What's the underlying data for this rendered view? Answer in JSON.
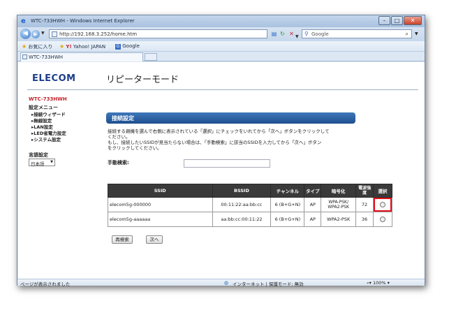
{
  "window": {
    "title": "WTC-733HWH - Windows Internet Explorer",
    "buttons": {
      "minimize": "–",
      "maximize": "□",
      "close": "✕"
    }
  },
  "address_bar": {
    "url": "http://192.168.3.252/home.htm",
    "search_placeholder": "Google"
  },
  "favorites_bar": {
    "favorites_label": "お気に入り",
    "links": [
      {
        "label": "Yahoo! JAPAN"
      },
      {
        "label": "Google"
      }
    ]
  },
  "tab": {
    "label": "WTC-733HWH"
  },
  "page": {
    "logo": "ELECOM",
    "title": "リピーターモード",
    "sidebar": {
      "model": "WTC-733HWH",
      "menu_title": "設定メニュー",
      "items": [
        {
          "label": "▸接続ウィザード"
        },
        {
          "label": "▸無線設定"
        },
        {
          "label": "▸LAN設定"
        },
        {
          "label": "▸LED省電力設定"
        },
        {
          "label": "▸システム設定"
        }
      ],
      "language_label": "言語設定",
      "language_value": "日本語"
    },
    "section_header": "接続設定",
    "description": [
      "接続する親機を選んで右側に表示されている「選択」にチェックをいれてから「次へ」ボタンをクリックして",
      "ください。",
      "もし、接続したいSSIDが見当たらない場合は、「手動検索」に該当のSSIDを入力してから「次へ」ボタン",
      "をクリックしてください。"
    ],
    "manual_search_label": "手動検索:",
    "manual_search_value": "",
    "table": {
      "headers": [
        "SSID",
        "BSSID",
        "チャンネル",
        "タイプ",
        "暗号化",
        "電波強度",
        "選択"
      ],
      "rows": [
        {
          "ssid": "elecom5g-000000",
          "bssid": "00:11:22:aa:bb:cc",
          "channel": "6 (B+G+N)",
          "type": "AP",
          "encryption": "WPA-PSK/ WPA2-PSK",
          "signal": "72",
          "selected": false
        },
        {
          "ssid": "elecom5g-aaaaaa",
          "bssid": "aa:bb:cc:00:11:22",
          "channel": "6 (B+G+N)",
          "type": "AP",
          "encryption": "WPA2-PSK",
          "signal": "36",
          "selected": false
        }
      ]
    },
    "buttons": {
      "rescan": "再検索",
      "next": "次へ"
    }
  },
  "status_bar": {
    "left": "ページが表示されました",
    "zone": "インターネット | 保護モード: 無効",
    "zoom": "100%"
  },
  "colors": {
    "accent": "#1e4f8f",
    "logo": "#1d3d8a",
    "model_text": "#c0252d",
    "highlight": "#e0121b"
  }
}
